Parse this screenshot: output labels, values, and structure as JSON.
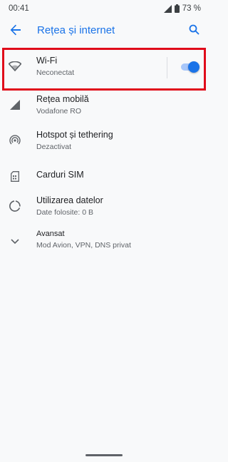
{
  "status_bar": {
    "time": "00:41",
    "battery": "73 %",
    "icons": [
      "signal-icon",
      "battery-icon"
    ]
  },
  "app_bar": {
    "title": "Rețea și internet",
    "back_icon": "arrow-back-icon",
    "search_icon": "search-icon",
    "accent_color": "#1a73e8"
  },
  "settings": [
    {
      "label": "Wi-Fi",
      "summary": "Neconectat",
      "icon": "wifi-icon",
      "toggle_on": true
    },
    {
      "label": "Rețea mobilă",
      "summary": "Vodafone RO",
      "icon": "cellular-icon"
    },
    {
      "label": "Hotspot și tethering",
      "summary": "Dezactivat",
      "icon": "hotspot-icon"
    },
    {
      "label": "Carduri SIM",
      "summary": "",
      "icon": "sim-card-icon"
    },
    {
      "label": "Utilizarea datelor",
      "summary": "Date folosite: 0 B",
      "icon": "data-usage-icon"
    },
    {
      "label": "Avansat",
      "summary": "Mod Avion, VPN, DNS privat",
      "icon": "chevron-down-icon"
    }
  ],
  "highlight_color": "#e00b1a"
}
